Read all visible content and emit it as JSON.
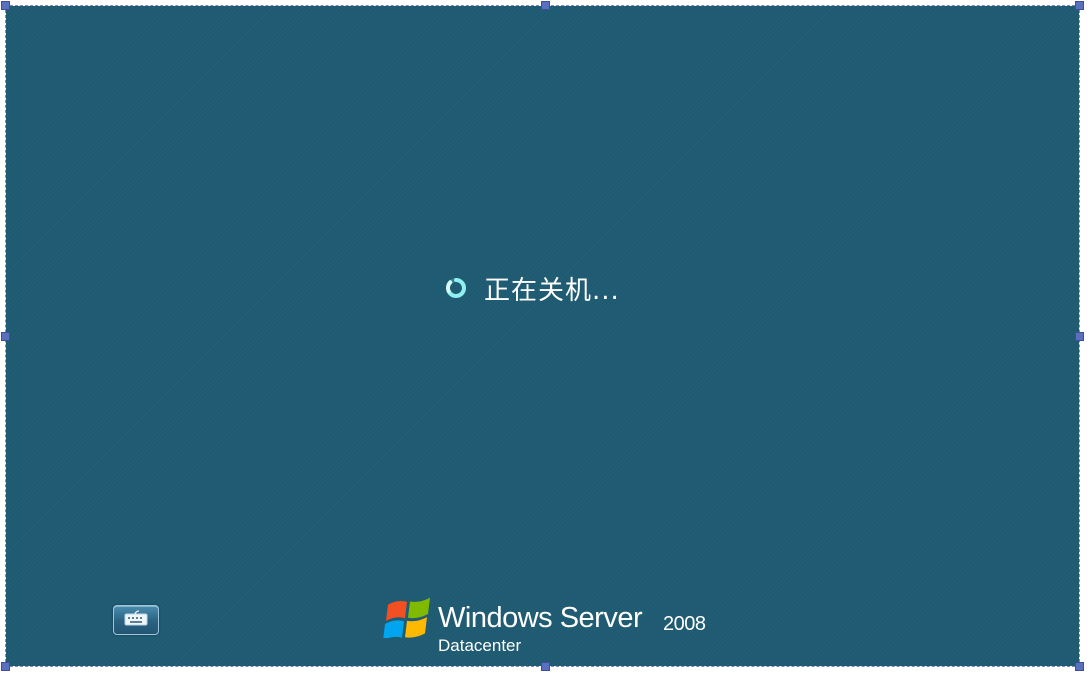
{
  "status": {
    "icon": "loading-spinner-icon",
    "text": "正在关机..."
  },
  "accessibility_button": {
    "icon": "keyboard-icon"
  },
  "branding": {
    "logo": "windows-flag-logo",
    "product_name": "Windows Server",
    "version": "2008",
    "edition": "Datacenter"
  },
  "colors": {
    "background": "#1e5a72",
    "text": "#ffffff",
    "spinner": "#7fe3e6",
    "selection_handle": "#5b6fbf"
  }
}
